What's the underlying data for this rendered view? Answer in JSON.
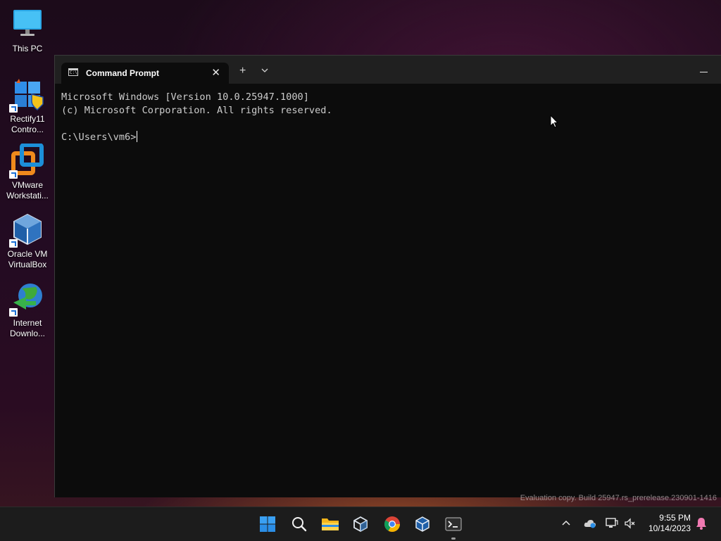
{
  "desktop": {
    "icons": [
      {
        "label": "This PC"
      },
      {
        "label": "Rectify11 Contro..."
      },
      {
        "label": "VMware Workstati..."
      },
      {
        "label": "Oracle VM VirtualBox"
      },
      {
        "label": "Internet Downlo..."
      }
    ]
  },
  "window": {
    "tab_title": "Command Prompt",
    "tab_close": "✕",
    "new_tab": "+",
    "dropdown": "⌄",
    "minimize": "—",
    "console_lines": [
      "Microsoft Windows [Version 10.0.25947.1000]",
      "(c) Microsoft Corporation. All rights reserved.",
      "",
      "C:\\Users\\vm6>"
    ]
  },
  "watermark": "Evaluation copy. Build 25947.rs_prerelease.230901-1416",
  "taskbar": {
    "apps": [
      "start-icon",
      "search-icon",
      "file-explorer-icon",
      "vmware-icon",
      "chrome-icon",
      "virtualbox-icon",
      "terminal-icon"
    ],
    "running": "terminal-icon",
    "tray": {
      "chevron": "^"
    },
    "clock": {
      "time": "9:55 PM",
      "date": "10/14/2023"
    }
  },
  "colors": {
    "accent": "#0078d4",
    "console_bg": "#0c0c0c",
    "console_fg": "#cccccc",
    "titlebar": "#202020",
    "taskbar": "#1c1c1c"
  }
}
